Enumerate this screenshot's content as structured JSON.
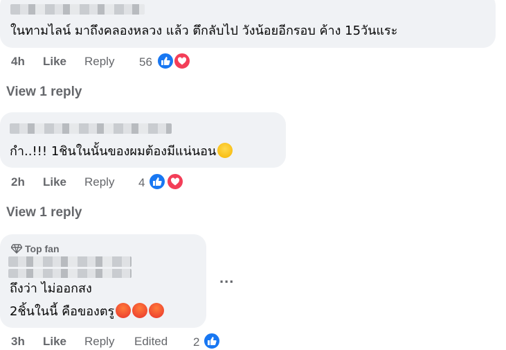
{
  "comments": [
    {
      "text": "ในทามไลน์ มาถึงคลองหลวง แล้ว ตึกลับไป วังน้อยอีกรอบ ค้าง 15วันแระ",
      "time": "4h",
      "like_label": "Like",
      "reply_label": "Reply",
      "reaction_count": "56",
      "reactions": [
        "like-icon",
        "love-icon"
      ],
      "view_replies": "View 1 reply"
    },
    {
      "text": "กำ..!!! 1ชินในนั้นของผมต้องมีแน่นอน",
      "emoji": "thinking-face-icon",
      "time": "2h",
      "like_label": "Like",
      "reply_label": "Reply",
      "reaction_count": "4",
      "reactions": [
        "like-icon",
        "love-icon"
      ],
      "view_replies": "View 1 reply"
    },
    {
      "badge": "Top fan",
      "text_line1": "ถึงว่า ไม่ออกสง",
      "text_line2": "2ชิ้นในนี้ คือของตรู",
      "emojis": [
        "angry-face-icon",
        "angry-face-icon",
        "angry-face-icon"
      ],
      "time": "3h",
      "like_label": "Like",
      "reply_label": "Reply",
      "edited_label": "Edited",
      "reaction_count": "2",
      "reactions": [
        "like-icon"
      ],
      "more_label": "..."
    }
  ],
  "colors": {
    "bubble": "#f0f2f5",
    "meta": "#65676b",
    "like": "#1877f2",
    "love": "#f33e58"
  }
}
